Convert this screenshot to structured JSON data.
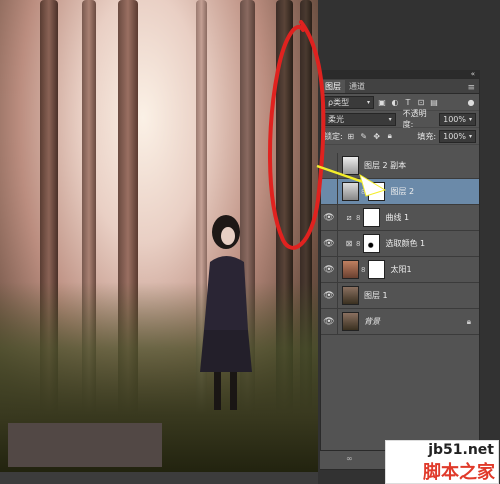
{
  "panel": {
    "top_arrows": "«",
    "tabs": [
      {
        "label": "图层",
        "active": true
      },
      {
        "label": "通道",
        "active": false
      }
    ],
    "menu_icon": "≡",
    "filter": {
      "label": "ρ类型",
      "icons": [
        "image-icon",
        "adjust-icon",
        "text-icon",
        "shape-icon",
        "smart-icon"
      ]
    },
    "blend": {
      "mode": "柔光",
      "opacity_label": "不透明度:",
      "opacity_value": "100%"
    },
    "lock": {
      "label": "锁定:",
      "fill_label": "填充:",
      "fill_value": "100%"
    },
    "layers": [
      {
        "name": "图层 2 副本",
        "visible": false,
        "selected": false,
        "thumb": "#c9c9c9",
        "mask": false,
        "lock": false
      },
      {
        "name": "图层 2",
        "visible": false,
        "selected": true,
        "thumb": "#bdbdbd",
        "mask": true,
        "lock": false
      },
      {
        "name": "曲线 1",
        "visible": true,
        "selected": false,
        "thumb": "adjust",
        "mask": true,
        "lock": false
      },
      {
        "name": "选取颜色 1",
        "visible": true,
        "selected": false,
        "thumb": "adjust",
        "mask": true,
        "lock": false
      },
      {
        "name": "太阳1",
        "visible": true,
        "selected": false,
        "thumb": "#8a5a3a",
        "mask": true,
        "lock": false
      },
      {
        "name": "图层 1",
        "visible": true,
        "selected": false,
        "thumb": "#6f5a48",
        "mask": false,
        "lock": false
      },
      {
        "name": "背景",
        "visible": true,
        "selected": false,
        "thumb": "#6f5a48",
        "mask": false,
        "lock": true
      }
    ],
    "bottom_icon": "∞"
  },
  "watermark": {
    "site": "jb51.net",
    "name": "脚本之家"
  },
  "colors": {
    "annotation_red": "#e0221f",
    "arrow_yellow": "#f4ee2a",
    "selection": "#6b8aa9"
  }
}
